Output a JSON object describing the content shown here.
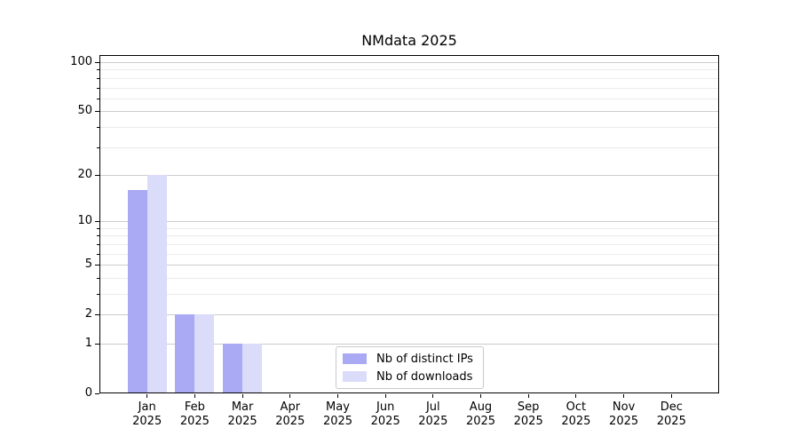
{
  "title": "NMdata 2025",
  "colors": {
    "distinct_ips": "#a9a9f4",
    "downloads": "#dbdbfa",
    "grid_major": "#cccccc",
    "grid_minor": "#ebebeb",
    "axis": "#000000",
    "legend_border": "#c9c9c9"
  },
  "legend": {
    "items": [
      {
        "label": "Nb of distinct IPs",
        "color_key": "distinct_ips"
      },
      {
        "label": "Nb of downloads",
        "color_key": "downloads"
      }
    ]
  },
  "x_axis": {
    "months": [
      "Jan",
      "Feb",
      "Mar",
      "Apr",
      "May",
      "Jun",
      "Jul",
      "Aug",
      "Sep",
      "Oct",
      "Nov",
      "Dec"
    ],
    "year": "2025"
  },
  "y_axis": {
    "scale": "log1p",
    "major_ticks": [
      0,
      1,
      2,
      5,
      10,
      20,
      50,
      100
    ],
    "minor_gridlines": [
      3,
      4,
      6,
      7,
      8,
      9,
      30,
      40,
      60,
      70,
      80,
      90
    ]
  },
  "chart_data": {
    "type": "bar",
    "title": "NMdata 2025",
    "categories": [
      "Jan 2025",
      "Feb 2025",
      "Mar 2025",
      "Apr 2025",
      "May 2025",
      "Jun 2025",
      "Jul 2025",
      "Aug 2025",
      "Sep 2025",
      "Oct 2025",
      "Nov 2025",
      "Dec 2025"
    ],
    "series": [
      {
        "name": "Nb of distinct IPs",
        "color_key": "distinct_ips",
        "values": [
          16,
          2,
          1,
          0,
          0,
          0,
          0,
          0,
          0,
          0,
          0,
          0
        ]
      },
      {
        "name": "Nb of downloads",
        "color_key": "downloads",
        "values": [
          20,
          2,
          1,
          0,
          0,
          0,
          0,
          0,
          0,
          0,
          0,
          0
        ]
      }
    ],
    "xlabel": "",
    "ylabel": "",
    "yscale": "log1p",
    "y_ticks": [
      0,
      1,
      2,
      5,
      10,
      20,
      50,
      100
    ],
    "ylim": [
      0,
      112
    ],
    "grid": true,
    "legend_position": "lower center"
  }
}
